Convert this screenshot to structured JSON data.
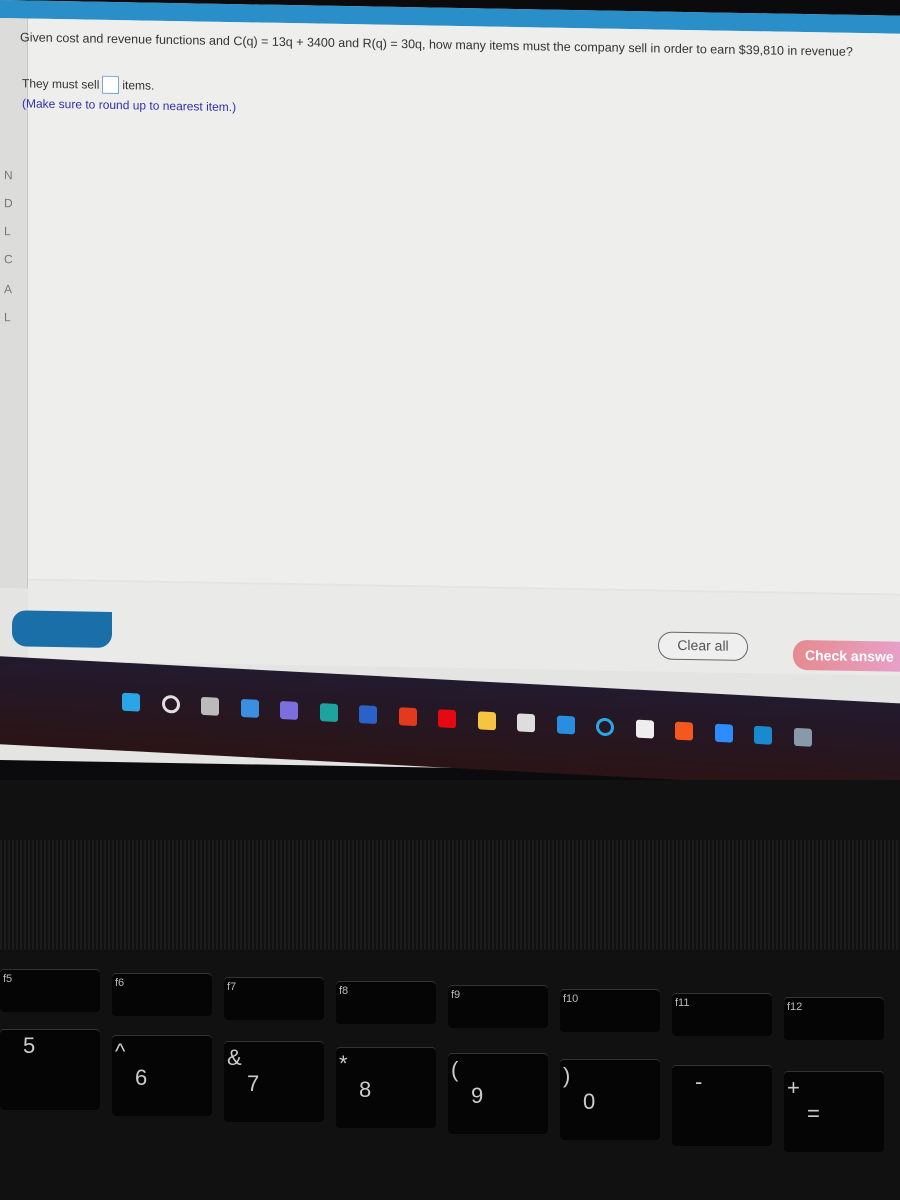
{
  "question": {
    "text": "Given cost and revenue functions and C(q) = 13q + 3400 and R(q) = 30q, how many items must the company sell in order to earn $39,810 in revenue?",
    "answer_prefix": "They must sell",
    "answer_value": "",
    "answer_suffix": "items.",
    "hint": "(Make sure to round up to nearest item.)"
  },
  "left_strip": [
    "N",
    "D",
    "L",
    "C",
    "A",
    "L"
  ],
  "buttons": {
    "clear": "Clear all",
    "check": "Check answe"
  },
  "taskbar": [
    {
      "icon": "windows-start-icon",
      "color": "#2aa6e8"
    },
    {
      "icon": "search-icon",
      "color": "#e0e0e0"
    },
    {
      "icon": "task-view-icon",
      "color": "#bbbbbb"
    },
    {
      "icon": "widgets-icon",
      "color": "#3b8fe0"
    },
    {
      "icon": "teams-chat-icon",
      "color": "#7b6fe0"
    },
    {
      "icon": "edge-icon",
      "color": "#1fa3a0"
    },
    {
      "icon": "word-icon",
      "color": "#2b62c7"
    },
    {
      "icon": "office-icon",
      "color": "#e33a1e"
    },
    {
      "icon": "netflix-icon",
      "color": "#e50914"
    },
    {
      "icon": "file-explorer-icon",
      "color": "#f5c542"
    },
    {
      "icon": "microsoft-store-icon",
      "color": "#dddddd"
    },
    {
      "icon": "mail-icon",
      "color": "#2a8ee0"
    },
    {
      "icon": "cortana-icon",
      "color": "#2aa6e8"
    },
    {
      "icon": "app-icon",
      "color": "#eeeeee"
    },
    {
      "icon": "soundcloud-icon",
      "color": "#f5581e"
    },
    {
      "icon": "zoom-icon",
      "color": "#2d8cff"
    },
    {
      "icon": "prime-video-icon",
      "color": "#1a8ad0"
    },
    {
      "icon": "camera-icon",
      "color": "#8899aa"
    }
  ],
  "keys": [
    {
      "f": "f5",
      "main": "5"
    },
    {
      "f": "f6",
      "main": "6",
      "alt": "^"
    },
    {
      "f": "f7",
      "main": "7",
      "alt": "&"
    },
    {
      "f": "f8",
      "main": "8",
      "alt": "*"
    },
    {
      "f": "f9",
      "main": "9",
      "alt": "("
    },
    {
      "f": "f10",
      "main": "0",
      "alt": ")"
    },
    {
      "f": "f11",
      "main": "-"
    },
    {
      "f": "f12",
      "main": "=",
      "alt": "+"
    }
  ]
}
